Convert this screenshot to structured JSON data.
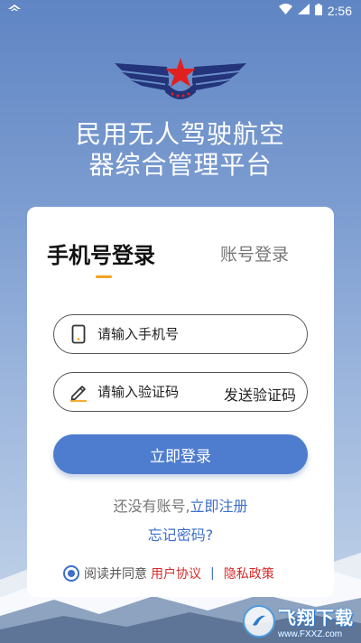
{
  "status_bar": {
    "time": "2:56",
    "icons": [
      "app-notification-icon",
      "wifi-icon",
      "signal-icon",
      "battery-icon"
    ]
  },
  "header": {
    "title_line1": "民用无人驾驶航空",
    "title_line2": "器综合管理平台"
  },
  "login": {
    "tab_phone": "手机号登录",
    "tab_account": "账号登录",
    "phone_placeholder": "请输入手机号",
    "code_placeholder": "请输入验证码",
    "send_code": "发送验证码",
    "login_button": "立即登录",
    "no_account": "还没有账号,",
    "register": "立即注册",
    "forgot": "忘记密码?",
    "agree_prefix": "阅读并同意",
    "user_agreement": "用户协议",
    "separator": "|",
    "privacy_policy": "隐私政策"
  },
  "watermark": {
    "text": "飞翔下载",
    "url": "www.FXXZ.com"
  },
  "colors": {
    "primary": "#4e7dcf",
    "link": "#3d6fc9",
    "accent": "#f2a21b",
    "danger": "#d42a2a",
    "logo_red": "#e02020",
    "logo_navy": "#23347a"
  }
}
